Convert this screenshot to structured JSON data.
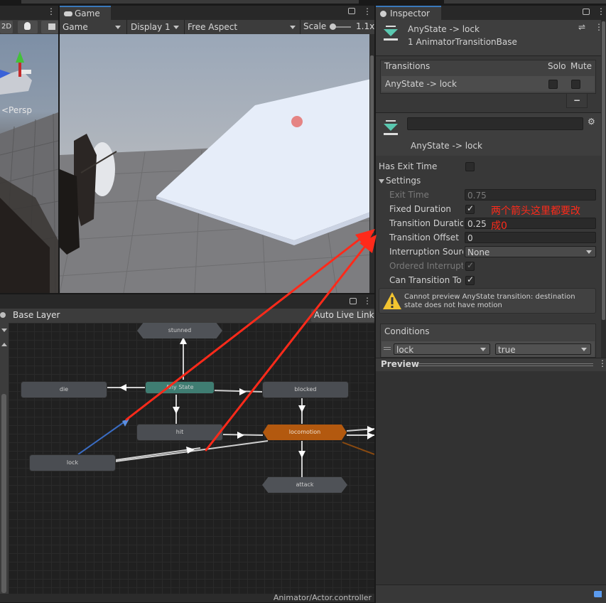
{
  "game_tab": {
    "label": "Game"
  },
  "game_toolbar": {
    "display_mode": "Game",
    "display": "Display 1",
    "aspect": "Free Aspect",
    "scale_label": "Scale",
    "scale_value": "1.1x"
  },
  "scene_toolbar": {
    "mode_2d": "2D"
  },
  "scene_view": {
    "persp_label": "<Persp"
  },
  "animator": {
    "layer": "Base Layer",
    "auto_live_link": "Auto Live Link",
    "footer_path": "Animator/Actor.controller",
    "nodes": {
      "stunned": "stunned",
      "die": "die",
      "any_state": "Any State",
      "blocked": "blocked",
      "hit": "hit",
      "locomotion": "locomotion",
      "lock": "lock",
      "attack": "attack"
    }
  },
  "inspector": {
    "tab_label": "Inspector",
    "header_title": "AnyState -> lock",
    "header_subtitle": "1 AnimatorTransitionBase",
    "transitions": {
      "header": "Transitions",
      "solo": "Solo",
      "mute": "Mute",
      "row_label": "AnyState -> lock",
      "remove_label": "−"
    },
    "transition_name": "AnyState -> lock",
    "has_exit_time": "Has Exit Time",
    "settings": "Settings",
    "exit_time_label": "Exit Time",
    "exit_time_value": "0.75",
    "fixed_duration_label": "Fixed Duration",
    "transition_duration_label": "Transition Duration",
    "transition_duration_value": "0.25",
    "transition_offset_label": "Transition Offset",
    "transition_offset_value": "0",
    "interruption_source_label": "Interruption Source",
    "interruption_source_value": "None",
    "ordered_interruption_label": "Ordered Interruption",
    "can_transition_label": "Can Transition To Self",
    "warning": "Cannot preview AnyState transition:  destination state does not have motion",
    "conditions": "Conditions",
    "condition_param": "lock",
    "condition_value": "true",
    "preview": "Preview"
  },
  "annotation": {
    "text_line1": "两个箭头这里都要改",
    "text_line2": "成0",
    "color": "#ff2a1a"
  }
}
